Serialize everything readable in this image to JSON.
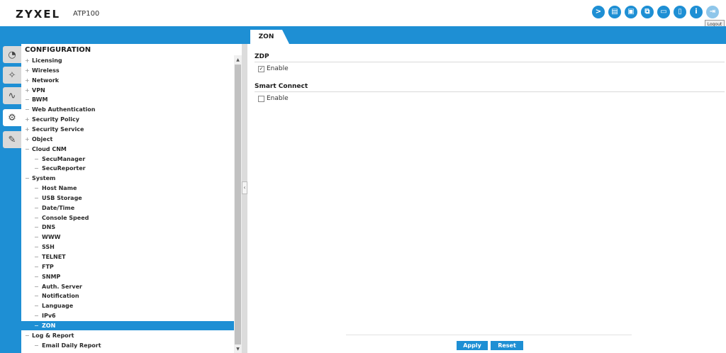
{
  "header": {
    "brand": "ZYXEL",
    "model": "ATP100",
    "icons": [
      "console-icon",
      "cli-icon",
      "window-icon",
      "network-icon",
      "chat-icon",
      "book-icon",
      "info-icon",
      "logout-icon"
    ],
    "logout_tooltip": "Logout"
  },
  "tab": {
    "label": "ZON"
  },
  "sidebar": {
    "title": "CONFIGURATION",
    "items": [
      {
        "sign": "+",
        "label": "Licensing",
        "level": 0
      },
      {
        "sign": "+",
        "label": "Wireless",
        "level": 0
      },
      {
        "sign": "+",
        "label": "Network",
        "level": 0
      },
      {
        "sign": "+",
        "label": "VPN",
        "level": 0
      },
      {
        "sign": "−",
        "label": "BWM",
        "level": 0
      },
      {
        "sign": "−",
        "label": "Web Authentication",
        "level": 0
      },
      {
        "sign": "+",
        "label": "Security Policy",
        "level": 0
      },
      {
        "sign": "+",
        "label": "Security Service",
        "level": 0
      },
      {
        "sign": "+",
        "label": "Object",
        "level": 0
      },
      {
        "sign": "−",
        "label": "Cloud CNM",
        "level": 0
      },
      {
        "sign": "−",
        "label": "SecuManager",
        "level": 1
      },
      {
        "sign": "−",
        "label": "SecuReporter",
        "level": 1
      },
      {
        "sign": "−",
        "label": "System",
        "level": 0
      },
      {
        "sign": "−",
        "label": "Host Name",
        "level": 1
      },
      {
        "sign": "−",
        "label": "USB Storage",
        "level": 1
      },
      {
        "sign": "−",
        "label": "Date/Time",
        "level": 1
      },
      {
        "sign": "−",
        "label": "Console Speed",
        "level": 1
      },
      {
        "sign": "−",
        "label": "DNS",
        "level": 1
      },
      {
        "sign": "−",
        "label": "WWW",
        "level": 1
      },
      {
        "sign": "−",
        "label": "SSH",
        "level": 1
      },
      {
        "sign": "−",
        "label": "TELNET",
        "level": 1
      },
      {
        "sign": "−",
        "label": "FTP",
        "level": 1
      },
      {
        "sign": "−",
        "label": "SNMP",
        "level": 1
      },
      {
        "sign": "−",
        "label": "Auth. Server",
        "level": 1
      },
      {
        "sign": "−",
        "label": "Notification",
        "level": 1
      },
      {
        "sign": "−",
        "label": "Language",
        "level": 1
      },
      {
        "sign": "−",
        "label": "IPv6",
        "level": 1
      },
      {
        "sign": "−",
        "label": "ZON",
        "level": 1,
        "selected": true
      },
      {
        "sign": "−",
        "label": "Log & Report",
        "level": 0
      },
      {
        "sign": "−",
        "label": "Email Daily Report",
        "level": 1
      }
    ]
  },
  "icon_strip": [
    "dashboard-icon",
    "wizard-icon",
    "monitor-icon",
    "configuration-icon",
    "maintenance-icon"
  ],
  "main": {
    "zdp": {
      "title": "ZDP",
      "enable_label": "Enable",
      "checked": true
    },
    "smart_connect": {
      "title": "Smart Connect",
      "enable_label": "Enable",
      "checked": false
    },
    "apply_label": "Apply",
    "reset_label": "Reset"
  },
  "colors": {
    "accent": "#1e8fd4",
    "selected_row": "#1e8fd4"
  }
}
